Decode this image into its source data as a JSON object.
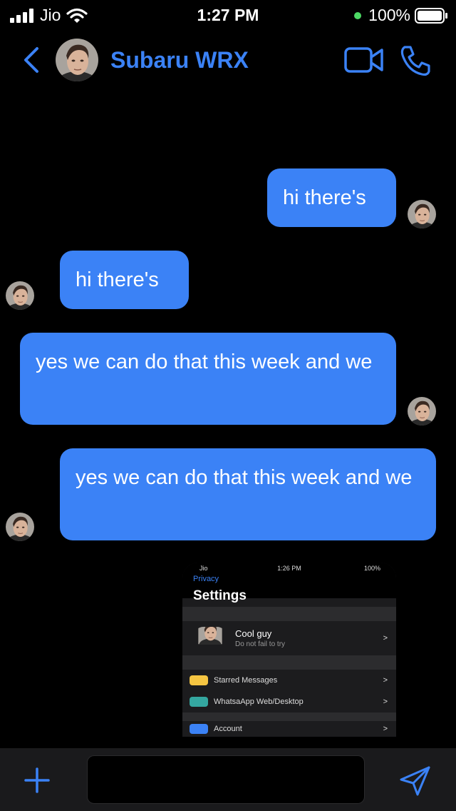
{
  "status_bar": {
    "carrier": "Jio",
    "time": "1:27 PM",
    "battery": "100%"
  },
  "chat": {
    "contact_name": "Subaru WRX"
  },
  "messages": [
    {
      "text": "hi there's",
      "direction": "sent"
    },
    {
      "text": "hi there's",
      "direction": "received"
    },
    {
      "text": "yes we can do that this week and we",
      "direction": "sent"
    },
    {
      "text": "yes we can do that this week and we",
      "direction": "received"
    }
  ],
  "attachment": {
    "status": {
      "carrier": "Jio",
      "time": "1:26 PM",
      "battery": "100%"
    },
    "back_label": "Privacy",
    "title": "Settings",
    "profile": {
      "name": "Cool guy",
      "status": "Do not fail to try",
      "chevron": ">"
    },
    "rows": [
      {
        "label": "Starred Messages",
        "icon": "star-icon",
        "color": "#f5c542",
        "chevron": ">"
      },
      {
        "label": "WhatsaApp Web/Desktop",
        "icon": "laptop-icon",
        "color": "#34a7a0",
        "chevron": ">"
      },
      {
        "label": "Account",
        "icon": "key-icon",
        "color": "#3b82f6",
        "chevron": ">"
      }
    ]
  },
  "composer": {
    "placeholder": ""
  },
  "colors": {
    "accent": "#3b82f6",
    "background": "#000000",
    "bar": "#1a1a1c"
  }
}
